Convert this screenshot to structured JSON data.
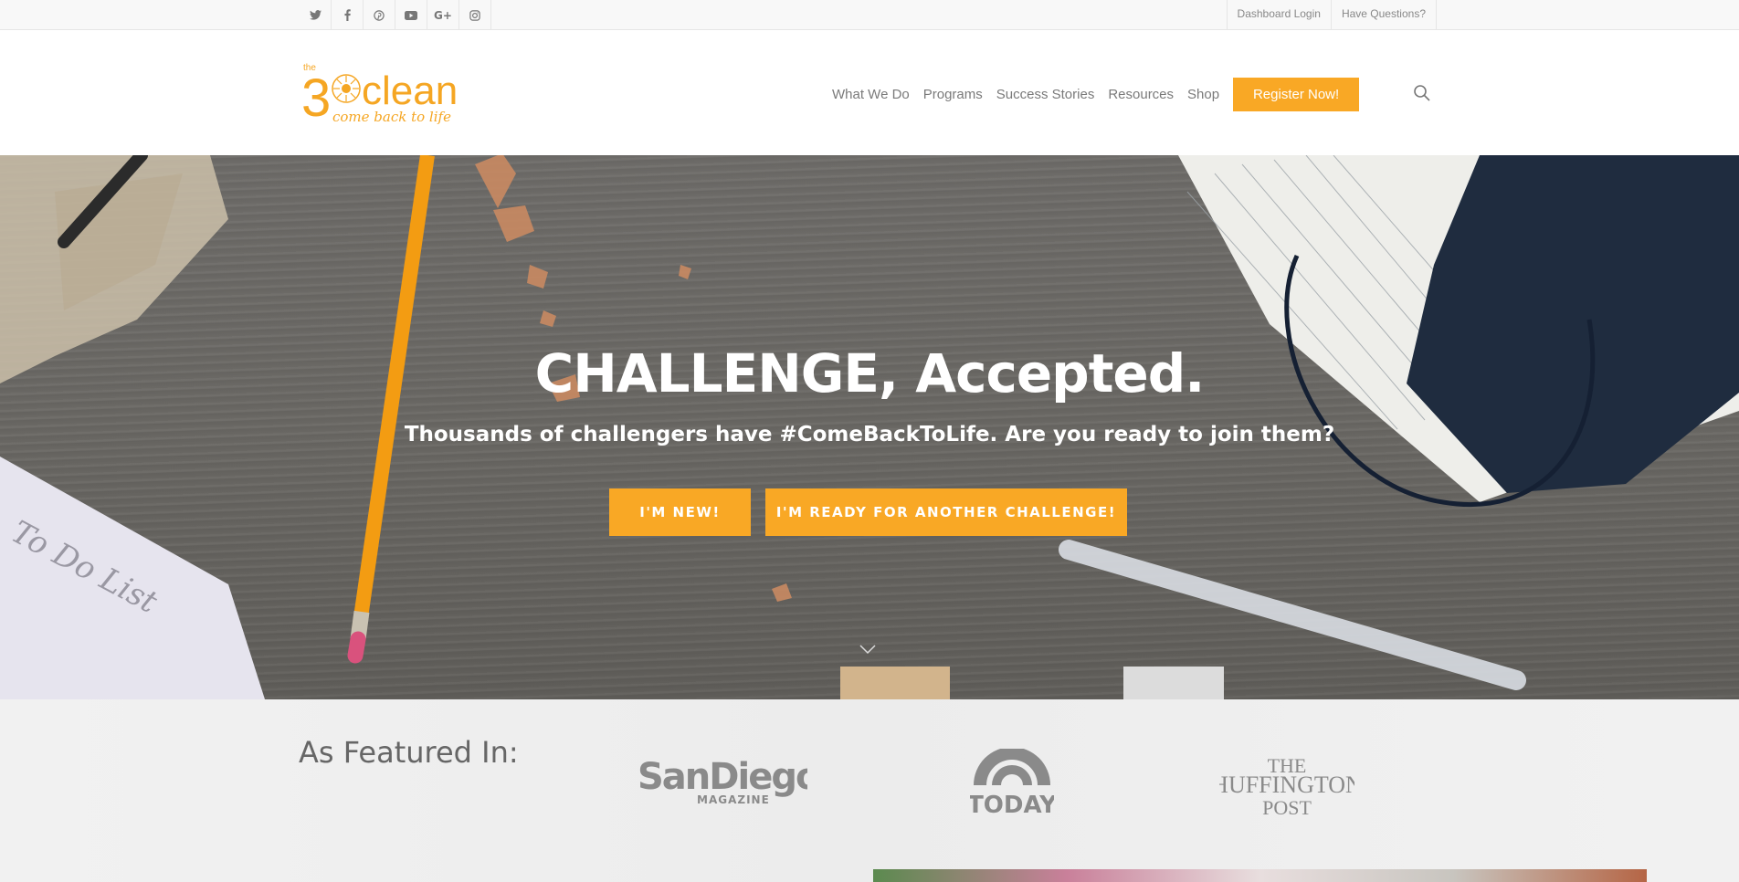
{
  "topbar": {
    "social": [
      "twitter-icon",
      "facebook-icon",
      "pinterest-icon",
      "youtube-icon",
      "google-plus-icon",
      "instagram-icon"
    ],
    "links": [
      "Dashboard Login",
      "Have Questions?"
    ]
  },
  "header": {
    "logo": {
      "small": "the",
      "number": "3",
      "word": "clean",
      "tagline": "come back to life"
    },
    "nav": [
      "What We Do",
      "Programs",
      "Success Stories",
      "Resources",
      "Shop"
    ],
    "register_label": "Register Now!"
  },
  "hero": {
    "title": "CHALLENGE, Accepted.",
    "subtitle": "Thousands of challengers have #ComeBackToLife. Are you ready to join them?",
    "btn_new": "I'M NEW!",
    "btn_again": "I'M READY FOR ANOTHER CHALLENGE!"
  },
  "featured": {
    "title": "As Featured In:",
    "logos": {
      "sandiego": "SanDiego",
      "sandiego_sub": "MAGAZINE",
      "today": "TODAY",
      "huff1": "THE",
      "huff2": "HUFFINGTON",
      "huff3": "POST"
    }
  },
  "colors": {
    "accent": "#f9a825"
  }
}
